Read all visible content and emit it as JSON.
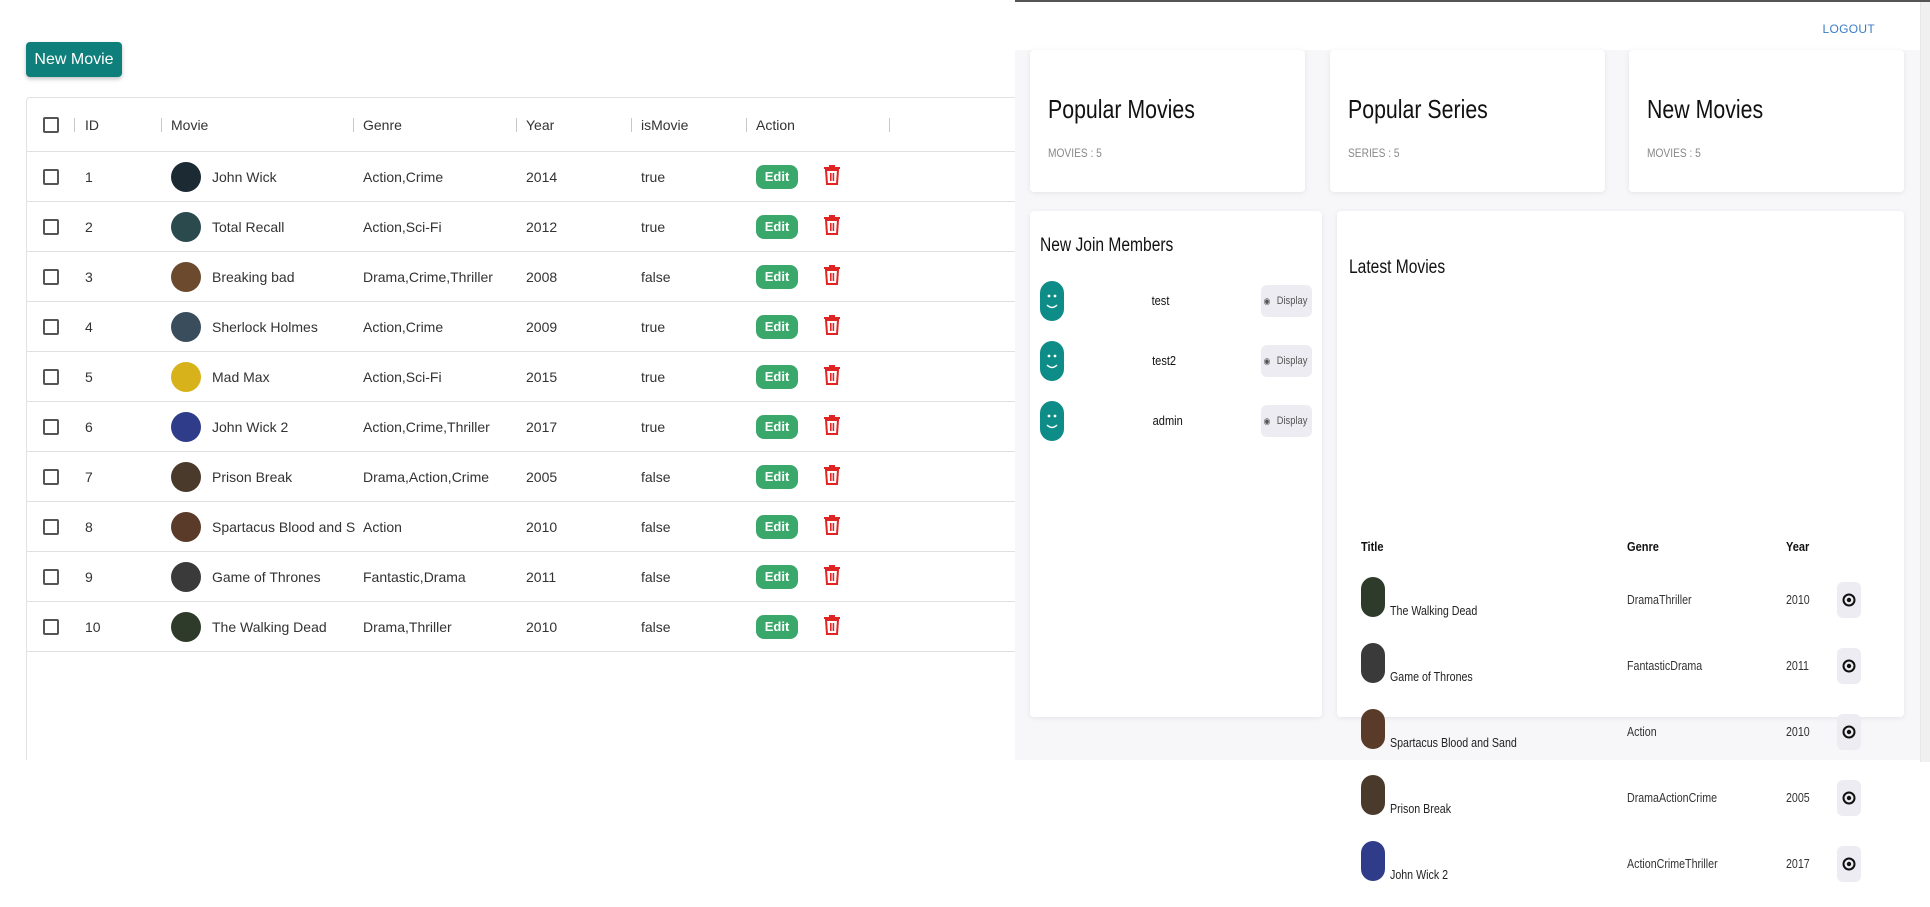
{
  "left": {
    "new_movie_label": "New Movie",
    "columns": [
      "ID",
      "Movie",
      "Genre",
      "Year",
      "isMovie",
      "Action"
    ],
    "edit_label": "Edit",
    "rows": [
      {
        "id": "1",
        "movie": "John Wick",
        "genre": "Action,Crime",
        "year": "2014",
        "is_movie": "true",
        "avatar_color": "#1c2a33"
      },
      {
        "id": "2",
        "movie": "Total Recall",
        "genre": "Action,Sci-Fi",
        "year": "2012",
        "is_movie": "true",
        "avatar_color": "#2a4a4e"
      },
      {
        "id": "3",
        "movie": "Breaking bad",
        "genre": "Drama,Crime,Thriller",
        "year": "2008",
        "is_movie": "false",
        "avatar_color": "#6b4a2e"
      },
      {
        "id": "4",
        "movie": "Sherlock Holmes",
        "genre": "Action,Crime",
        "year": "2009",
        "is_movie": "true",
        "avatar_color": "#3a4d5c"
      },
      {
        "id": "5",
        "movie": "Mad Max",
        "genre": "Action,Sci-Fi",
        "year": "2015",
        "is_movie": "true",
        "avatar_color": "#d8b21a"
      },
      {
        "id": "6",
        "movie": "John Wick 2",
        "genre": "Action,Crime,Thriller",
        "year": "2017",
        "is_movie": "true",
        "avatar_color": "#2e3c8a"
      },
      {
        "id": "7",
        "movie": "Prison Break",
        "genre": "Drama,Action,Crime",
        "year": "2005",
        "is_movie": "false",
        "avatar_color": "#4a3a2c"
      },
      {
        "id": "8",
        "movie": "Spartacus Blood and S",
        "genre": "Action",
        "year": "2010",
        "is_movie": "false",
        "avatar_color": "#5a3b2a"
      },
      {
        "id": "9",
        "movie": "Game of Thrones",
        "genre": "Fantastic,Drama",
        "year": "2011",
        "is_movie": "false",
        "avatar_color": "#3a3a3a"
      },
      {
        "id": "10",
        "movie": "The Walking Dead",
        "genre": "Drama,Thriller",
        "year": "2010",
        "is_movie": "false",
        "avatar_color": "#2f3b2a"
      }
    ]
  },
  "right": {
    "logout_label": "LOGOUT",
    "stats": [
      {
        "title": "Popular Movies",
        "sub": "MOVIES : 5"
      },
      {
        "title": "Popular Series",
        "sub": "SERIES : 5"
      },
      {
        "title": "New Movies",
        "sub": "MOVIES : 5"
      }
    ],
    "members_title": "New Join Members",
    "display_label": "Display",
    "members": [
      "test",
      "test2",
      "admin"
    ],
    "latest_title": "Latest Movies",
    "latest_headers": {
      "title": "Title",
      "genre": "Genre",
      "year": "Year"
    },
    "latest": [
      {
        "title": "The Walking Dead",
        "genre": "DramaThriller",
        "year": "2010",
        "poster_color": "#2f3b2a"
      },
      {
        "title": "Game of Thrones",
        "genre": "FantasticDrama",
        "year": "2011",
        "poster_color": "#3a3a3a"
      },
      {
        "title": "Spartacus Blood and Sand",
        "genre": "Action",
        "year": "2010",
        "poster_color": "#5a3b2a"
      },
      {
        "title": "Prison Break",
        "genre": "DramaActionCrime",
        "year": "2005",
        "poster_color": "#4a3a2c"
      },
      {
        "title": "John Wick 2",
        "genre": "ActionCrimeThriller",
        "year": "2017",
        "poster_color": "#2e3c8a"
      }
    ]
  },
  "colors": {
    "accent": "#0f7f7b",
    "edit": "#3aa86b",
    "delete": "#e02424",
    "link": "#3b7cc4"
  }
}
